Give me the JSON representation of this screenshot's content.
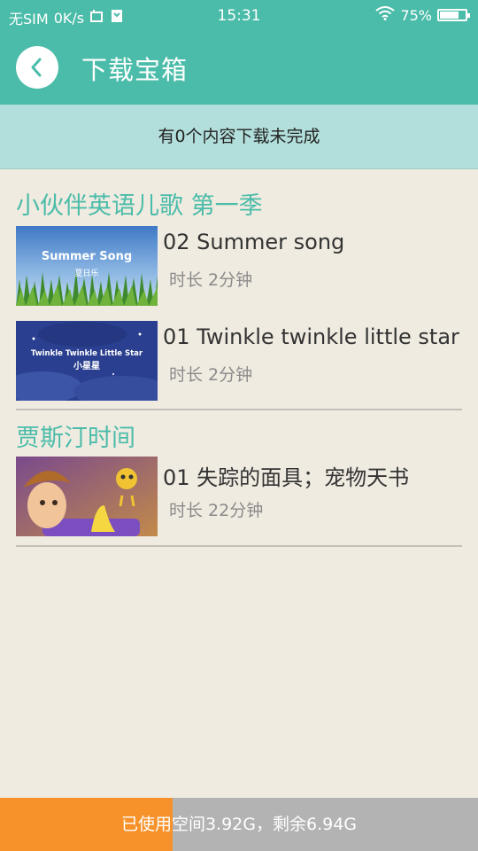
{
  "status": {
    "carrier": "无SIM",
    "speed": "0K/s",
    "time": "15:31",
    "battery": "75%",
    "battery_level": 0.75
  },
  "header": {
    "title": "下载宝箱",
    "back_icon": "chevron-left-icon"
  },
  "notice": "有0个内容下载未完成",
  "sections": [
    {
      "title": "小伙伴英语儿歌 第一季",
      "items": [
        {
          "title": "02 Summer song",
          "duration": "时长 2分钟",
          "thumb_text": "Summer Song",
          "thumb_subtext": "夏日乐"
        },
        {
          "title": "01 Twinkle twinkle little star",
          "duration": "时长 2分钟",
          "thumb_text": "Twinkle Twinkle Little Star",
          "thumb_subtext": "小星星"
        }
      ]
    },
    {
      "title": "贾斯汀时间",
      "items": [
        {
          "title": "01 失踪的面具；宠物天书",
          "duration": "时长 22分钟"
        }
      ]
    }
  ],
  "storage": {
    "text": "已使用空间3.92G，剩余6.94G",
    "used_fraction": 0.361
  },
  "colors": {
    "accent": "#4bbca9",
    "notice_bg": "#b2dfdb",
    "page_bg": "#f0ebe1",
    "storage_used": "#f7922a",
    "storage_free": "#b3b3b3"
  }
}
